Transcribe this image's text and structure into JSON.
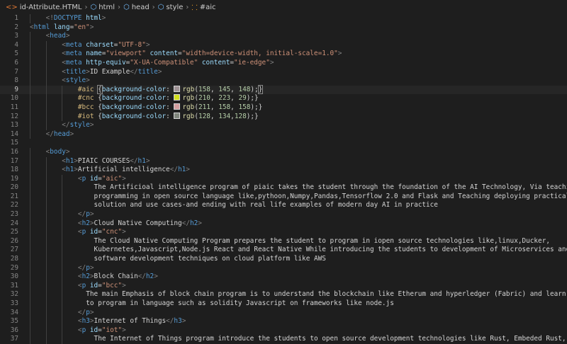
{
  "breadcrumb": {
    "items": [
      {
        "label": "id-Attribute.HTML",
        "icon": "html-file-icon",
        "name": "file",
        "glyph": "<>",
        "color": "#e37933"
      },
      {
        "label": "html",
        "icon": "element-icon",
        "name": "html",
        "glyph": "⬡",
        "color": "#75beff"
      },
      {
        "label": "head",
        "icon": "element-icon",
        "name": "head",
        "glyph": "⬡",
        "color": "#75beff"
      },
      {
        "label": "style",
        "icon": "element-icon",
        "name": "style",
        "glyph": "⬡",
        "color": "#75beff"
      },
      {
        "label": "#aic",
        "icon": "selector-icon",
        "name": "aic",
        "glyph": "⸬",
        "color": "#ee9d28"
      }
    ]
  },
  "editor": {
    "active_line": 9,
    "lines": [
      {
        "n": "1",
        "indent": 1,
        "tokens": [
          [
            "br",
            "<!"
          ],
          [
            "tag",
            "DOCTYPE"
          ],
          [
            "tx",
            " "
          ],
          [
            "at",
            "html"
          ],
          [
            "br",
            ">"
          ]
        ]
      },
      {
        "n": "2",
        "indent": 0,
        "tokens": [
          [
            "br",
            "<"
          ],
          [
            "tag",
            "html"
          ],
          [
            "tx",
            " "
          ],
          [
            "at",
            "lang"
          ],
          [
            "tx",
            "="
          ],
          [
            "st",
            "\"en\""
          ],
          [
            "br",
            ">"
          ]
        ]
      },
      {
        "n": "3",
        "indent": 1,
        "tokens": [
          [
            "br",
            "<"
          ],
          [
            "tag",
            "head"
          ],
          [
            "br",
            ">"
          ]
        ]
      },
      {
        "n": "4",
        "indent": 2,
        "tokens": [
          [
            "br",
            "<"
          ],
          [
            "tag",
            "meta"
          ],
          [
            "tx",
            " "
          ],
          [
            "at",
            "charset"
          ],
          [
            "tx",
            "="
          ],
          [
            "st",
            "\"UTF-8\""
          ],
          [
            "br",
            ">"
          ]
        ]
      },
      {
        "n": "5",
        "indent": 2,
        "tokens": [
          [
            "br",
            "<"
          ],
          [
            "tag",
            "meta"
          ],
          [
            "tx",
            " "
          ],
          [
            "at",
            "name"
          ],
          [
            "tx",
            "="
          ],
          [
            "st",
            "\"viewport\""
          ],
          [
            "tx",
            " "
          ],
          [
            "at",
            "content"
          ],
          [
            "tx",
            "="
          ],
          [
            "st",
            "\"width=device-width, initial-scale=1.0\""
          ],
          [
            "br",
            ">"
          ]
        ]
      },
      {
        "n": "6",
        "indent": 2,
        "tokens": [
          [
            "br",
            "<"
          ],
          [
            "tag",
            "meta"
          ],
          [
            "tx",
            " "
          ],
          [
            "at",
            "http-equiv"
          ],
          [
            "tx",
            "="
          ],
          [
            "st",
            "\"X-UA-Compatible\""
          ],
          [
            "tx",
            " "
          ],
          [
            "at",
            "content"
          ],
          [
            "tx",
            "="
          ],
          [
            "st",
            "\"ie-edge\""
          ],
          [
            "br",
            ">"
          ]
        ]
      },
      {
        "n": "7",
        "indent": 2,
        "tokens": [
          [
            "br",
            "<"
          ],
          [
            "tag",
            "title"
          ],
          [
            "br",
            ">"
          ],
          [
            "tx",
            "ID Example"
          ],
          [
            "br",
            "</"
          ],
          [
            "tag",
            "title"
          ],
          [
            "br",
            ">"
          ]
        ]
      },
      {
        "n": "8",
        "indent": 2,
        "tokens": [
          [
            "br",
            "<"
          ],
          [
            "tag",
            "style"
          ],
          [
            "br",
            ">"
          ]
        ]
      },
      {
        "n": "9",
        "indent": 3,
        "tokens": [
          [
            "sel",
            "#aic"
          ],
          [
            "tx",
            " "
          ],
          [
            "ck",
            "{"
          ],
          [
            "pr",
            "background-color"
          ],
          [
            "tx",
            ": "
          ],
          [
            "sw",
            "#9e9194"
          ],
          [
            "fn",
            "rgb"
          ],
          [
            "tx",
            "("
          ],
          [
            "nu",
            "158"
          ],
          [
            "tx",
            ", "
          ],
          [
            "nu",
            "145"
          ],
          [
            "tx",
            ", "
          ],
          [
            "nu",
            "148"
          ],
          [
            "tx",
            ");"
          ],
          [
            "ck",
            "}"
          ]
        ]
      },
      {
        "n": "10",
        "indent": 3,
        "tokens": [
          [
            "sel",
            "#cnc"
          ],
          [
            "tx",
            " {"
          ],
          [
            "pr",
            "background-color"
          ],
          [
            "tx",
            ": "
          ],
          [
            "sw",
            "#d2df1d"
          ],
          [
            "fn",
            "rgb"
          ],
          [
            "tx",
            "("
          ],
          [
            "nu",
            "210"
          ],
          [
            "tx",
            ", "
          ],
          [
            "nu",
            "223"
          ],
          [
            "tx",
            ", "
          ],
          [
            "nu",
            "29"
          ],
          [
            "tx",
            ");}"
          ]
        ]
      },
      {
        "n": "11",
        "indent": 3,
        "tokens": [
          [
            "sel",
            "#bcc"
          ],
          [
            "tx",
            " {"
          ],
          [
            "pr",
            "background-color"
          ],
          [
            "tx",
            ": "
          ],
          [
            "sw",
            "#d39e9e"
          ],
          [
            "fn",
            "rgb"
          ],
          [
            "tx",
            "("
          ],
          [
            "nu",
            "211"
          ],
          [
            "tx",
            ", "
          ],
          [
            "nu",
            "158"
          ],
          [
            "tx",
            ", "
          ],
          [
            "nu",
            "158"
          ],
          [
            "tx",
            ");}"
          ]
        ]
      },
      {
        "n": "12",
        "indent": 3,
        "tokens": [
          [
            "sel",
            "#iot"
          ],
          [
            "tx",
            " {"
          ],
          [
            "pr",
            "background-color"
          ],
          [
            "tx",
            ": "
          ],
          [
            "sw",
            "#80867c"
          ],
          [
            "fn",
            "rgb"
          ],
          [
            "tx",
            "("
          ],
          [
            "nu",
            "128"
          ],
          [
            "tx",
            ", "
          ],
          [
            "nu",
            "134"
          ],
          [
            "tx",
            ","
          ],
          [
            "nu",
            "128"
          ],
          [
            "tx",
            ");}"
          ]
        ]
      },
      {
        "n": "13",
        "indent": 2,
        "tokens": [
          [
            "br",
            "</"
          ],
          [
            "tag",
            "style"
          ],
          [
            "br",
            ">"
          ]
        ]
      },
      {
        "n": "14",
        "indent": 1,
        "tokens": [
          [
            "br",
            "</"
          ],
          [
            "tag",
            "head"
          ],
          [
            "br",
            ">"
          ]
        ]
      },
      {
        "n": "15",
        "indent": 0,
        "tokens": []
      },
      {
        "n": "16",
        "indent": 1,
        "tokens": [
          [
            "br",
            "<"
          ],
          [
            "tag",
            "body"
          ],
          [
            "br",
            ">"
          ]
        ]
      },
      {
        "n": "17",
        "indent": 2,
        "tokens": [
          [
            "br",
            "<"
          ],
          [
            "tag",
            "h1"
          ],
          [
            "br",
            ">"
          ],
          [
            "tx",
            "PIAIC COURSES"
          ],
          [
            "br",
            "</"
          ],
          [
            "tag",
            "h1"
          ],
          [
            "br",
            ">"
          ]
        ]
      },
      {
        "n": "18",
        "indent": 2,
        "tokens": [
          [
            "br",
            "<"
          ],
          [
            "tag",
            "h1"
          ],
          [
            "br",
            ">"
          ],
          [
            "tx",
            "Artificial intelligence"
          ],
          [
            "br",
            "</"
          ],
          [
            "tag",
            "h1"
          ],
          [
            "br",
            ">"
          ]
        ]
      },
      {
        "n": "19",
        "indent": 3,
        "tokens": [
          [
            "br",
            "<"
          ],
          [
            "tag",
            "p"
          ],
          [
            "tx",
            " "
          ],
          [
            "at",
            "id"
          ],
          [
            "tx",
            "="
          ],
          [
            "st",
            "\"aic\""
          ],
          [
            "br",
            ">"
          ]
        ]
      },
      {
        "n": "20",
        "indent": 4,
        "tokens": [
          [
            "tx",
            "The Artificioal intelligence program of piaic takes the student through the foundation of the AI Technology, Via teaching"
          ]
        ]
      },
      {
        "n": "21",
        "indent": 4,
        "tokens": [
          [
            "tx",
            "programming in open source language like,pythoon,Numpy,Pandas,Tensorflow 2.0 and Flask and Teaching deploying practical AI"
          ]
        ]
      },
      {
        "n": "22",
        "indent": 4,
        "tokens": [
          [
            "tx",
            "solution and use cases-and ending with real life examples of modern day AI in practice"
          ]
        ]
      },
      {
        "n": "23",
        "indent": 3,
        "tokens": [
          [
            "br",
            "</"
          ],
          [
            "tag",
            "p"
          ],
          [
            "br",
            ">"
          ]
        ]
      },
      {
        "n": "24",
        "indent": 3,
        "tokens": [
          [
            "br",
            "<"
          ],
          [
            "tag",
            "h2"
          ],
          [
            "br",
            ">"
          ],
          [
            "tx",
            "Cloud Native Computing"
          ],
          [
            "br",
            "</"
          ],
          [
            "tag",
            "h2"
          ],
          [
            "br",
            ">"
          ]
        ]
      },
      {
        "n": "25",
        "indent": 3,
        "tokens": [
          [
            "br",
            "<"
          ],
          [
            "tag",
            "p"
          ],
          [
            "tx",
            " "
          ],
          [
            "at",
            "id"
          ],
          [
            "tx",
            "="
          ],
          [
            "st",
            "\"cnc\""
          ],
          [
            "br",
            ">"
          ]
        ]
      },
      {
        "n": "26",
        "indent": 4,
        "tokens": [
          [
            "tx",
            "The Cloud Native Computing Program prepares the student to program in iopen source technologies like,linux,Ducker,"
          ]
        ]
      },
      {
        "n": "27",
        "indent": 4,
        "tokens": [
          [
            "tx",
            "Kubernetes,Javascript,Node.js React and React Native While introducing the students to development of Microservices and"
          ]
        ]
      },
      {
        "n": "28",
        "indent": 4,
        "tokens": [
          [
            "tx",
            "software development techniques on cloud platform like AWS"
          ]
        ]
      },
      {
        "n": "29",
        "indent": 3,
        "tokens": [
          [
            "br",
            "</"
          ],
          [
            "tag",
            "p"
          ],
          [
            "br",
            ">"
          ]
        ]
      },
      {
        "n": "30",
        "indent": 3,
        "tokens": [
          [
            "br",
            "<"
          ],
          [
            "tag",
            "h2"
          ],
          [
            "br",
            ">"
          ],
          [
            "tx",
            "Block Chain"
          ],
          [
            "br",
            "</"
          ],
          [
            "tag",
            "h2"
          ],
          [
            "br",
            ">"
          ]
        ]
      },
      {
        "n": "31",
        "indent": 3,
        "tokens": [
          [
            "br",
            "<"
          ],
          [
            "tag",
            "p"
          ],
          [
            "tx",
            " "
          ],
          [
            "at",
            "id"
          ],
          [
            "tx",
            "="
          ],
          [
            "st",
            "\"bcc\""
          ],
          [
            "br",
            ">"
          ]
        ]
      },
      {
        "n": "32",
        "indent": 4,
        "pad": -2,
        "tokens": [
          [
            "tx",
            "The main Emphasis of block chain program is to understand the blockchain like Etherum and hyperledger (Fabric) and learn"
          ]
        ]
      },
      {
        "n": "33",
        "indent": 4,
        "pad": -2,
        "tokens": [
          [
            "tx",
            "to program in language such as solidity Javascript on frameworks like node.js"
          ]
        ]
      },
      {
        "n": "34",
        "indent": 3,
        "tokens": [
          [
            "br",
            "</"
          ],
          [
            "tag",
            "p"
          ],
          [
            "br",
            ">"
          ]
        ]
      },
      {
        "n": "35",
        "indent": 3,
        "tokens": [
          [
            "br",
            "<"
          ],
          [
            "tag",
            "h3"
          ],
          [
            "br",
            ">"
          ],
          [
            "tx",
            "Internet of Things"
          ],
          [
            "br",
            "</"
          ],
          [
            "tag",
            "h3"
          ],
          [
            "br",
            ">"
          ]
        ]
      },
      {
        "n": "36",
        "indent": 3,
        "tokens": [
          [
            "br",
            "<"
          ],
          [
            "tag",
            "p"
          ],
          [
            "tx",
            " "
          ],
          [
            "at",
            "id"
          ],
          [
            "tx",
            "="
          ],
          [
            "st",
            "\"iot\""
          ],
          [
            "br",
            ">"
          ]
        ]
      },
      {
        "n": "37",
        "indent": 4,
        "tokens": [
          [
            "tx",
            "The Internet of Things program introduce the students to open source development technologies like Rust, Embeded Rust,"
          ]
        ]
      }
    ]
  }
}
